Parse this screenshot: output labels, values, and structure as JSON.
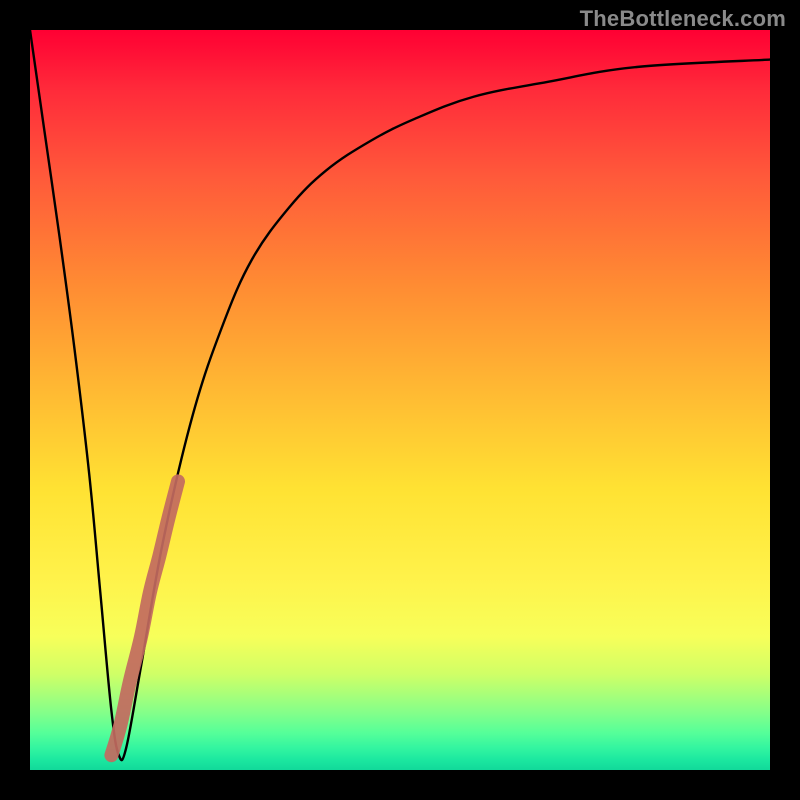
{
  "watermark": "TheBottleneck.com",
  "colors": {
    "curve": "#000000",
    "highlight": "#c26a5f",
    "background_top": "#ff0033",
    "background_bottom": "#12d99a",
    "frame": "#000000"
  },
  "chart_data": {
    "type": "line",
    "title": "",
    "xlabel": "",
    "ylabel": "",
    "xlim": [
      0,
      100
    ],
    "ylim": [
      0,
      100
    ],
    "grid": false,
    "legend": false,
    "series": [
      {
        "name": "bottleneck-curve",
        "x": [
          0,
          2,
          4,
          6,
          8,
          9.5,
          11,
          12,
          13,
          15,
          18,
          22,
          26,
          30,
          35,
          40,
          46,
          52,
          60,
          70,
          82,
          100
        ],
        "y": [
          100,
          86,
          72,
          57,
          40,
          24,
          8,
          2,
          3,
          14,
          31,
          48,
          60,
          69,
          76,
          81,
          85,
          88,
          91,
          93,
          95,
          96
        ]
      },
      {
        "name": "highlight-segment",
        "x": [
          11,
          12.2,
          13.5,
          15,
          16.2,
          17.5,
          18.7,
          20
        ],
        "y": [
          2,
          6,
          12,
          18,
          24,
          29,
          34,
          39
        ]
      }
    ],
    "annotations": []
  }
}
